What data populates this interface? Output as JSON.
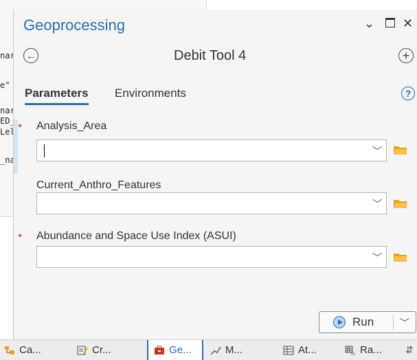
{
  "background_code": {
    "lines": [
      "nar",
      "e\"",
      "nar",
      "ED_",
      "Lel",
      "_na"
    ]
  },
  "pane": {
    "title": "Geoprocessing",
    "tool_name": "Debit Tool 4",
    "tabs": [
      {
        "label": "Parameters",
        "active": true
      },
      {
        "label": "Environments",
        "active": false
      }
    ],
    "parameters": [
      {
        "label": "Analysis_Area",
        "required": true,
        "value": ""
      },
      {
        "label": "Current_Anthro_Features",
        "required": false,
        "value": ""
      },
      {
        "label": "Abundance and Space Use Index (ASUI)",
        "required": true,
        "value": ""
      }
    ],
    "required_marker": "*",
    "run_label": "Run"
  },
  "bottom_tabs": [
    {
      "label": "Ca...",
      "icon": "catalog-icon"
    },
    {
      "label": "Cr...",
      "icon": "create-features-icon"
    },
    {
      "label": "Ge...",
      "icon": "geoprocessing-icon",
      "active": true
    },
    {
      "label": "M...",
      "icon": "modify-features-icon"
    },
    {
      "label": "At...",
      "icon": "attributes-icon"
    },
    {
      "label": "Ra...",
      "icon": "raster-function-icon"
    }
  ],
  "colors": {
    "accent": "#2e6da4",
    "required": "#c0392b",
    "folder": "#f0b429"
  }
}
